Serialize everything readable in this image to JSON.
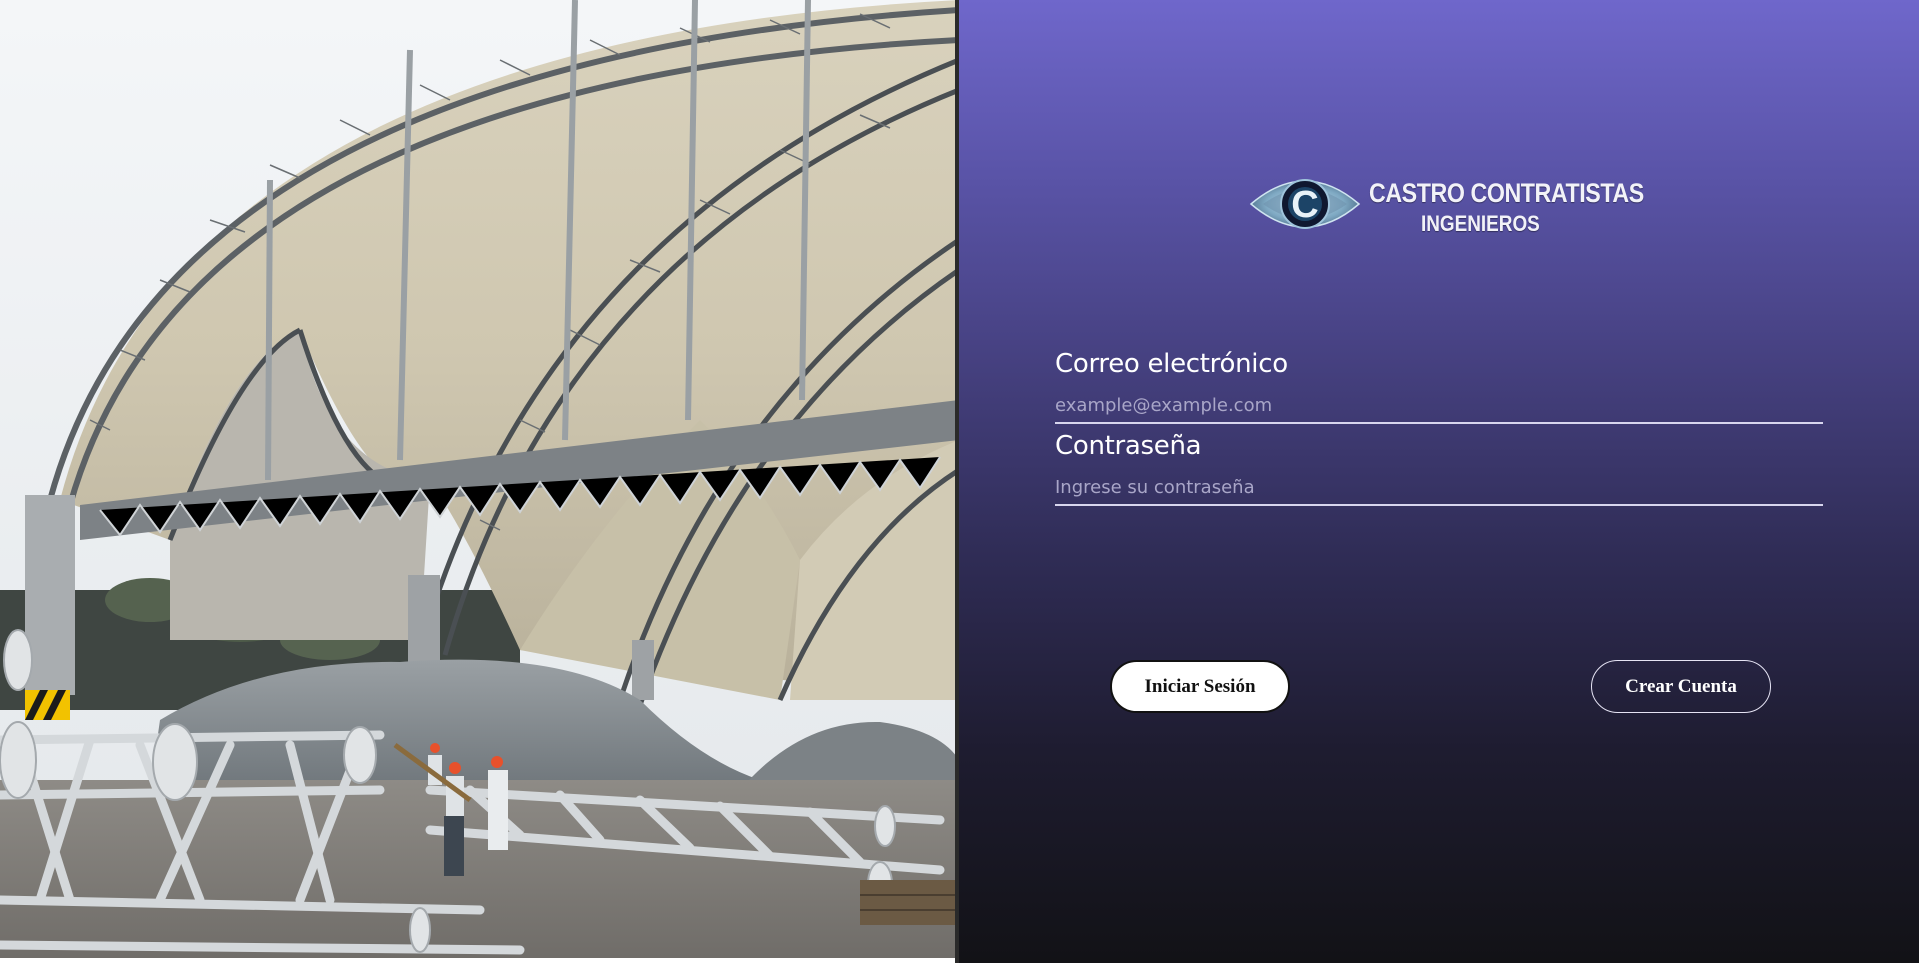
{
  "branding": {
    "line1": "CASTRO CONTRATISTAS",
    "line2": "INGENIEROS",
    "emblem_letter": "C"
  },
  "form": {
    "email": {
      "label": "Correo electrónico",
      "placeholder": "example@example.com",
      "value": ""
    },
    "password": {
      "label": "Contraseña",
      "placeholder": "Ingrese su contraseña",
      "value": ""
    }
  },
  "actions": {
    "login_label": "Iniciar Sesión",
    "create_account_label": "Crear Cuenta"
  },
  "colors": {
    "panel_top": "#6f67cb",
    "panel_bottom": "#121216",
    "login_button_bg": "#ffffff",
    "input_underline": "#d8d6ee"
  },
  "icons": {
    "logo_emblem": "castro-c-emblem-icon"
  }
}
